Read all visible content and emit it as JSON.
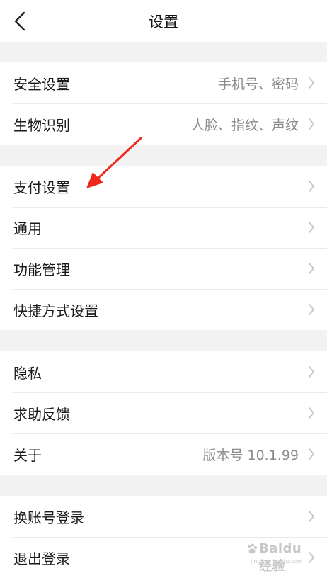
{
  "header": {
    "title": "设置",
    "back_icon": "chevron-left-icon"
  },
  "groups": [
    {
      "rows": [
        {
          "label": "安全设置",
          "value": "手机号、密码"
        },
        {
          "label": "生物识别",
          "value": "人脸、指纹、声纹"
        }
      ]
    },
    {
      "rows": [
        {
          "label": "支付设置",
          "value": ""
        },
        {
          "label": "通用",
          "value": ""
        },
        {
          "label": "功能管理",
          "value": ""
        },
        {
          "label": "快捷方式设置",
          "value": ""
        }
      ]
    },
    {
      "rows": [
        {
          "label": "隐私",
          "value": ""
        },
        {
          "label": "求助反馈",
          "value": ""
        },
        {
          "label": "关于",
          "value": "版本号 10.1.99"
        }
      ]
    },
    {
      "rows": [
        {
          "label": "换账号登录",
          "value": ""
        },
        {
          "label": "退出登录",
          "value": ""
        }
      ]
    }
  ],
  "annotation": {
    "color": "#f0271c"
  },
  "watermark": {
    "text": "Baidu经验",
    "url": "jingyan.baidu.com"
  },
  "colors": {
    "background": "#f2f2f2",
    "row_background": "#ffffff",
    "label": "#1a1a1a",
    "value": "#8c8c8c",
    "chevron": "#c4c4c4"
  }
}
